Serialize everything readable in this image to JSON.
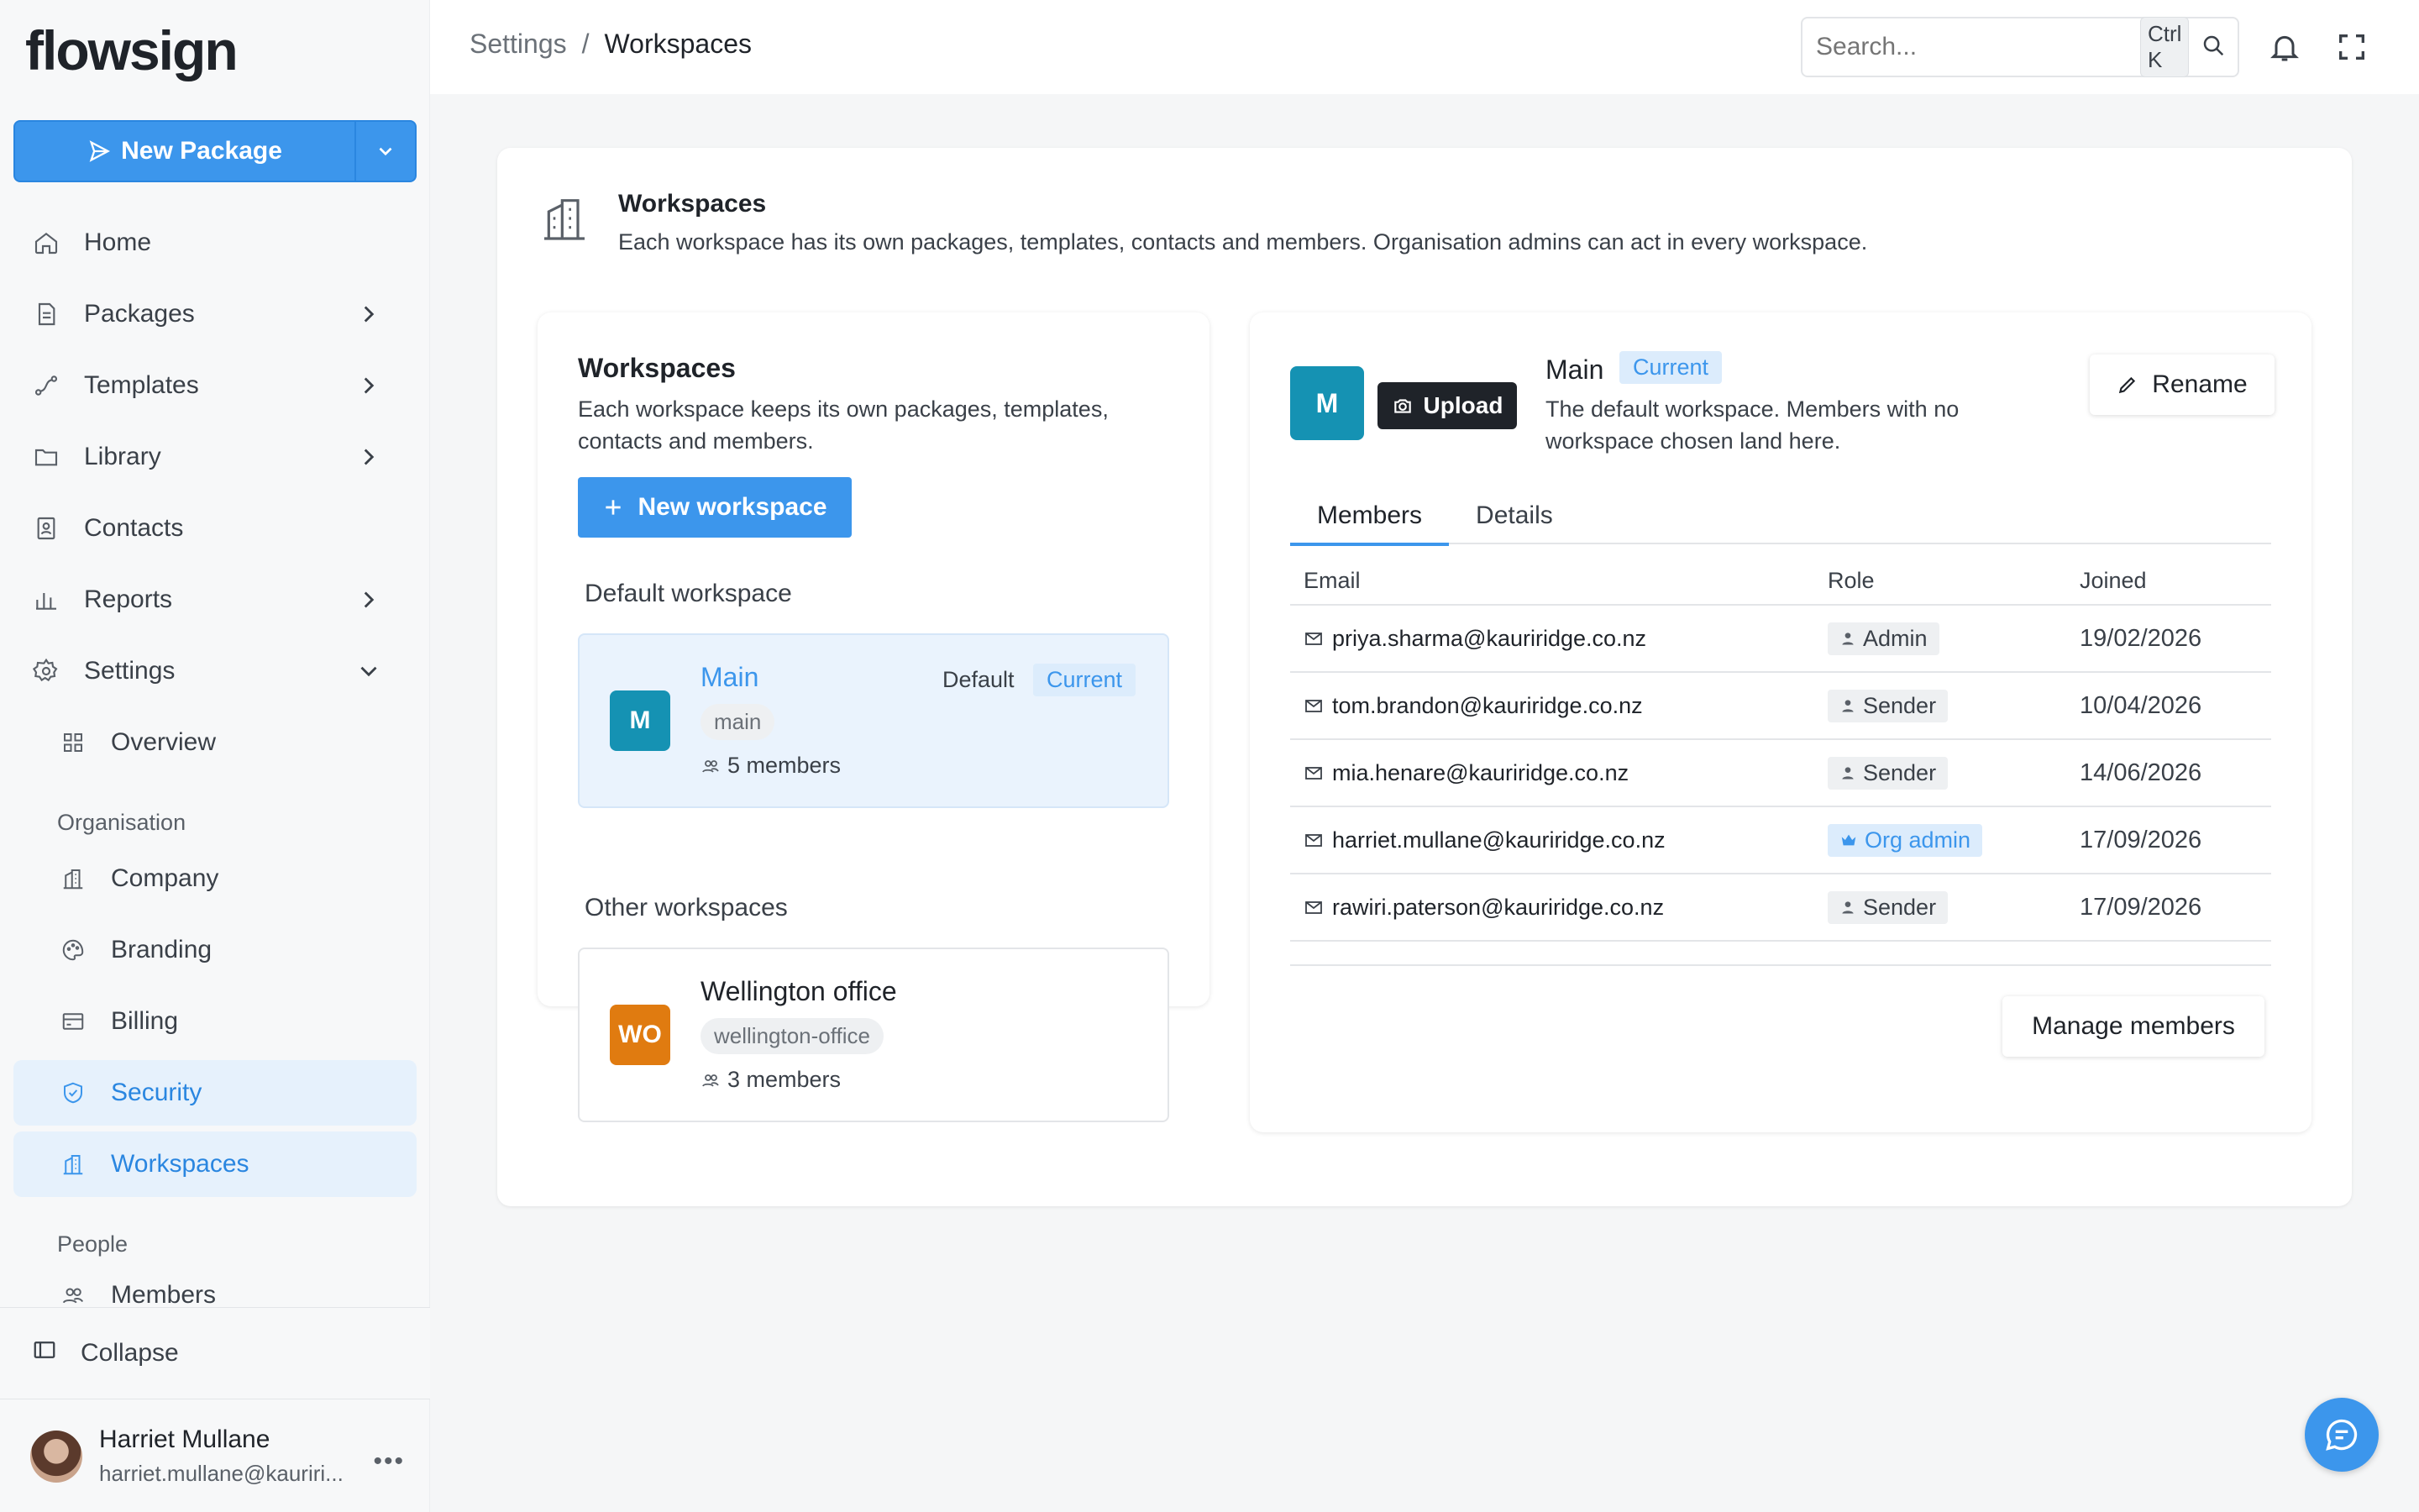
{
  "app": {
    "logo_text": "flowsign"
  },
  "sidebar": {
    "new_package_label": "New Package",
    "items": [
      {
        "label": "Home",
        "icon": "home-icon"
      },
      {
        "label": "Packages",
        "icon": "file-icon"
      },
      {
        "label": "Templates",
        "icon": "route-icon"
      },
      {
        "label": "Library",
        "icon": "folder-icon"
      },
      {
        "label": "Contacts",
        "icon": "contact-book-icon"
      },
      {
        "label": "Reports",
        "icon": "bar-chart-icon"
      },
      {
        "label": "Settings",
        "icon": "gear-icon"
      }
    ],
    "settings_sub": {
      "overview": "Overview",
      "org_section": "Organisation",
      "company": "Company",
      "branding": "Branding",
      "billing": "Billing",
      "security": "Security",
      "workspaces": "Workspaces",
      "people_section": "People",
      "members": "Members"
    },
    "collapse_label": "Collapse",
    "user": {
      "name": "Harriet Mullane",
      "email": "harriet.mullane@kauriri..."
    }
  },
  "topbar": {
    "breadcrumb_parent": "Settings",
    "breadcrumb_sep": "/",
    "breadcrumb_current": "Workspaces",
    "search_placeholder": "Search...",
    "search_shortcut": "Ctrl K"
  },
  "page": {
    "title": "Workspaces",
    "description": "Each workspace has its own packages, templates, contacts and members. Organisation admins can act in every workspace."
  },
  "left_panel": {
    "title": "Workspaces",
    "description": "Each workspace keeps its own packages, templates, contacts and members.",
    "new_button": "New workspace",
    "default_section": "Default workspace",
    "other_section": "Other workspaces",
    "default_ws": {
      "initial": "M",
      "name": "Main",
      "slug": "main",
      "members": "5 members",
      "default_label": "Default",
      "current_label": "Current",
      "color": "#1592b3"
    },
    "other_ws": {
      "initial": "WO",
      "name": "Wellington office",
      "slug": "wellington-office",
      "members": "3 members",
      "color": "#e07b10"
    }
  },
  "right_panel": {
    "avatar_initial": "M",
    "upload_label": "Upload",
    "name": "Main",
    "current_badge": "Current",
    "description": "The default workspace. Members with no workspace chosen land here.",
    "rename_label": "Rename",
    "tabs": [
      "Members",
      "Details"
    ],
    "table_headers": [
      "Email",
      "Role",
      "Joined"
    ],
    "rows": [
      {
        "email": "priya.sharma@kauriridge.co.nz",
        "role": "Admin",
        "joined": "19/02/2026"
      },
      {
        "email": "tom.brandon@kauriridge.co.nz",
        "role": "Sender",
        "joined": "10/04/2026"
      },
      {
        "email": "mia.henare@kauriridge.co.nz",
        "role": "Sender",
        "joined": "14/06/2026"
      },
      {
        "email": "harriet.mullane@kauriridge.co.nz",
        "role": "Org admin",
        "joined": "17/09/2026"
      },
      {
        "email": "rawiri.paterson@kauriridge.co.nz",
        "role": "Sender",
        "joined": "17/09/2026"
      }
    ],
    "manage_label": "Manage members"
  },
  "colors": {
    "accent": "#3c96ec",
    "text": "#1f2329"
  }
}
